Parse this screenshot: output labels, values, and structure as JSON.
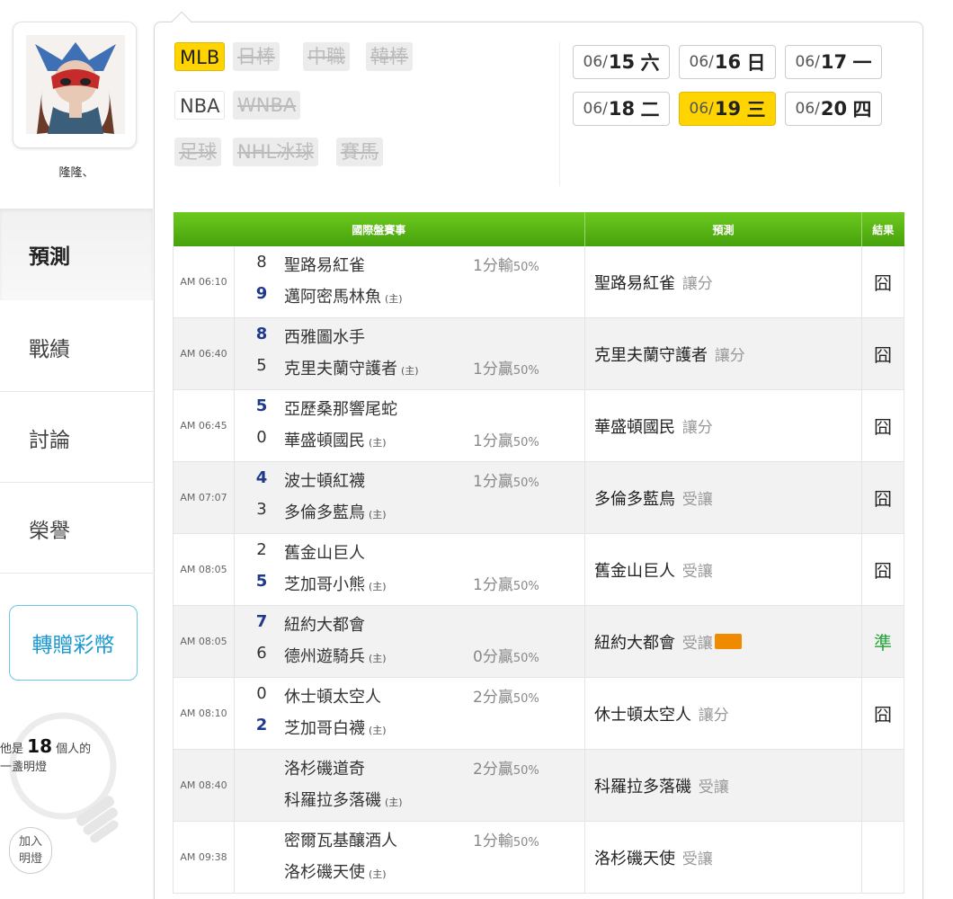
{
  "user": {
    "name": "隆隆、"
  },
  "nav": [
    {
      "label": "預測",
      "active": true
    },
    {
      "label": "戰績"
    },
    {
      "label": "討論"
    },
    {
      "label": "榮譽"
    }
  ],
  "gift_button": "轉贈彩幣",
  "lamp": {
    "prefix": "他是",
    "count": "18",
    "suffix": "個人的",
    "line2": "一盞明燈",
    "join": "加入明燈"
  },
  "leagues": [
    {
      "label": "MLB",
      "state": "on"
    },
    {
      "label": "日棒",
      "state": "off"
    },
    {
      "label": "中職",
      "state": "off"
    },
    {
      "label": "韓棒",
      "state": "off"
    },
    {
      "label": "NBA",
      "state": "plain"
    },
    {
      "label": "WNBA",
      "state": "off"
    },
    {
      "label": "足球",
      "state": "off"
    },
    {
      "label": "NHL冰球",
      "state": "off"
    },
    {
      "label": "賽馬",
      "state": "off"
    }
  ],
  "dates": [
    {
      "md": "06/",
      "day": "15",
      "dow": "六"
    },
    {
      "md": "06/",
      "day": "16",
      "dow": "日"
    },
    {
      "md": "06/",
      "day": "17",
      "dow": "一"
    },
    {
      "md": "06/",
      "day": "18",
      "dow": "二"
    },
    {
      "md": "06/",
      "day": "19",
      "dow": "三",
      "selected": true
    },
    {
      "md": "06/",
      "day": "20",
      "dow": "四"
    }
  ],
  "table": {
    "headers": [
      "國際盤賽事",
      "預測",
      "結果"
    ],
    "home_mark": "(主)",
    "rows": [
      {
        "time": "AM 06:10",
        "away": "聖路易紅雀",
        "home": "邁阿密馬林魚",
        "away_score": "8",
        "home_score": "9",
        "win": "home",
        "odds": "1分輸",
        "odds_pct": "50%",
        "odds_row": 1,
        "pick": "聖路易紅雀",
        "type": "讓分",
        "result": "囧"
      },
      {
        "time": "AM 06:40",
        "away": "西雅圖水手",
        "home": "克里夫蘭守護者",
        "away_score": "8",
        "home_score": "5",
        "win": "away",
        "odds": "1分贏",
        "odds_pct": "50%",
        "odds_row": 2,
        "pick": "克里夫蘭守護者",
        "type": "讓分",
        "result": "囧"
      },
      {
        "time": "AM 06:45",
        "away": "亞歷桑那響尾蛇",
        "home": "華盛頓國民",
        "away_score": "5",
        "home_score": "0",
        "win": "away",
        "odds": "1分贏",
        "odds_pct": "50%",
        "odds_row": 2,
        "pick": "華盛頓國民",
        "type": "讓分",
        "result": "囧"
      },
      {
        "time": "AM 07:07",
        "away": "波士頓紅襪",
        "home": "多倫多藍鳥",
        "away_score": "4",
        "home_score": "3",
        "win": "away",
        "odds": "1分贏",
        "odds_pct": "50%",
        "odds_row": 1,
        "pick": "多倫多藍鳥",
        "type": "受讓",
        "result": "囧"
      },
      {
        "time": "AM 08:05",
        "away": "舊金山巨人",
        "home": "芝加哥小熊",
        "away_score": "2",
        "home_score": "5",
        "win": "home",
        "odds": "1分贏",
        "odds_pct": "50%",
        "odds_row": 2,
        "pick": "舊金山巨人",
        "type": "受讓",
        "result": "囧"
      },
      {
        "time": "AM 08:05",
        "away": "紐約大都會",
        "home": "德州遊騎兵",
        "away_score": "7",
        "home_score": "6",
        "win": "away",
        "odds": "0分贏",
        "odds_pct": "50%",
        "odds_row": 2,
        "pick": "紐約大都會",
        "type": "受讓",
        "badge": true,
        "result": "準",
        "result_ok": true
      },
      {
        "time": "AM 08:10",
        "away": "休士頓太空人",
        "home": "芝加哥白襪",
        "away_score": "0",
        "home_score": "2",
        "win": "home",
        "odds": "2分贏",
        "odds_pct": "50%",
        "odds_row": 1,
        "pick": "休士頓太空人",
        "type": "讓分",
        "result": "囧"
      },
      {
        "time": "AM 08:40",
        "away": "洛杉磯道奇",
        "home": "科羅拉多落磯",
        "away_score": "",
        "home_score": "",
        "win": "",
        "odds": "2分贏",
        "odds_pct": "50%",
        "odds_row": 1,
        "pick": "科羅拉多落磯",
        "type": "受讓",
        "result": ""
      },
      {
        "time": "AM 09:38",
        "away": "密爾瓦基釀酒人",
        "home": "洛杉磯天使",
        "away_score": "",
        "home_score": "",
        "win": "",
        "odds": "1分輸",
        "odds_pct": "50%",
        "odds_row": 1,
        "pick": "洛杉磯天使",
        "type": "受讓",
        "result": ""
      }
    ]
  }
}
